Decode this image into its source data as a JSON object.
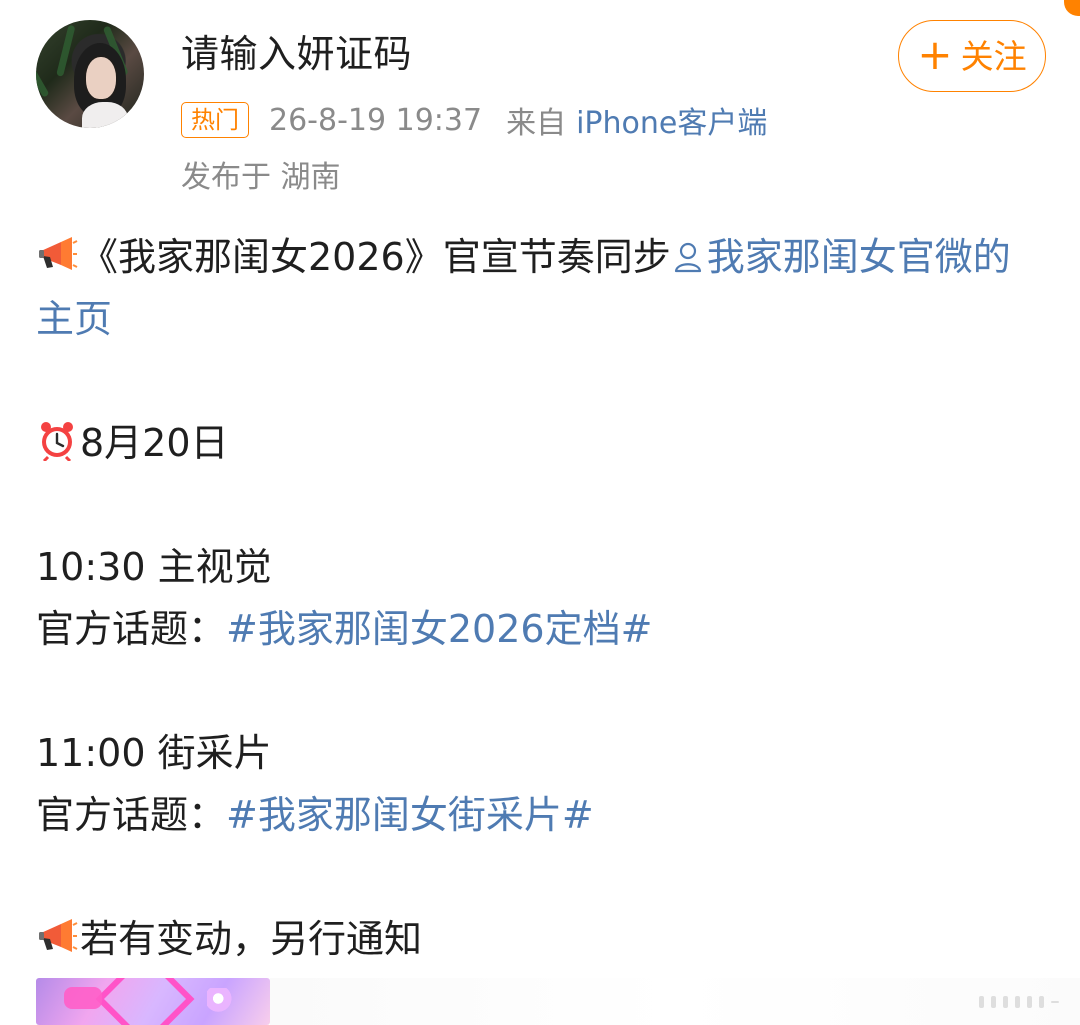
{
  "user": {
    "name": "请输入妍证码",
    "follow_label": "关注",
    "hot_badge": "热门",
    "time": "26-8-19 19:37",
    "source_prefix": "来自",
    "source": "iPhone客户端",
    "location": "发布于 湖南"
  },
  "post": {
    "line1_prefix": "《我家那闺女2026》官宣节奏同步",
    "line1_mention": "我家那闺女官微的主页",
    "date": "8月20日",
    "item1_time_title": "10:30 主视觉",
    "topic_label": "官方话题：",
    "item1_topic": "#我家那闺女2026定档#",
    "item2_time_title": "11:00 街采片",
    "item2_topic": "#我家那闺女街采片#",
    "notice": "若有变动，另行通知"
  },
  "colors": {
    "accent": "#ff8200",
    "link": "#4f7bb2",
    "meta": "#8a8a8a",
    "text": "#1f1f1f"
  },
  "icons": {
    "avatar": "avatar",
    "announcement": "megaphone-icon",
    "alarm": "alarm-clock-icon",
    "person": "person-icon",
    "more": "more-dots-icon"
  }
}
